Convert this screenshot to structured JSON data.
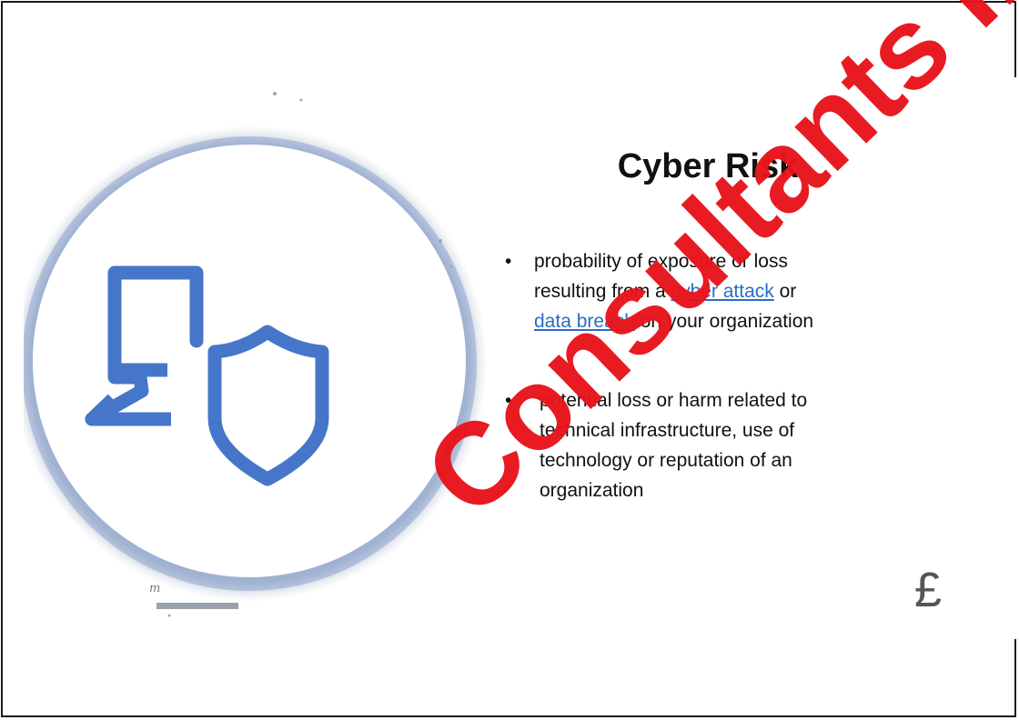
{
  "slide": {
    "title": "Cyber Risk",
    "bullets": [
      {
        "marker": "•",
        "line1": "probability of exposure or loss",
        "line2_pre": "resulting from  a ",
        "line2_link": "cyber attack",
        "line2_post": " or",
        "line3_link": "data  breach",
        "line3_post": " on your organization"
      },
      {
        "marker": "•",
        "text": "potential  loss or harm  related to technical  infrastructure,  use of technology or reputation  of an organization"
      }
    ],
    "symbol": "£",
    "small_mark": "m",
    "watermark": "Consultants Inc"
  },
  "colors": {
    "icon_blue": "#4676c9",
    "link_blue": "#2a6cc4",
    "watermark_red": "#e8141c"
  },
  "icons": [
    "laptop-icon",
    "shield-icon"
  ]
}
